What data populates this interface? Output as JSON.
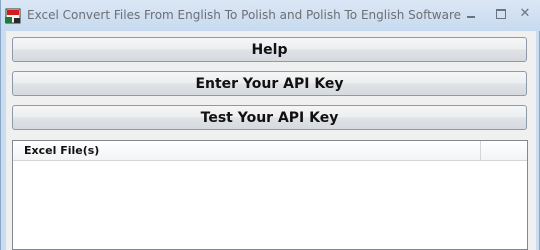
{
  "window": {
    "title": "Excel Convert Files From English To Polish and Polish To English Software"
  },
  "buttons": {
    "help": "Help",
    "enter_api_key": "Enter Your API Key",
    "test_api_key": "Test Your API Key"
  },
  "file_list": {
    "columns": [
      "Excel File(s)"
    ],
    "rows": []
  },
  "icons": {
    "app": "app-icon",
    "minimize": "minimize-icon",
    "maximize": "maximize-icon",
    "close": "close-icon"
  }
}
